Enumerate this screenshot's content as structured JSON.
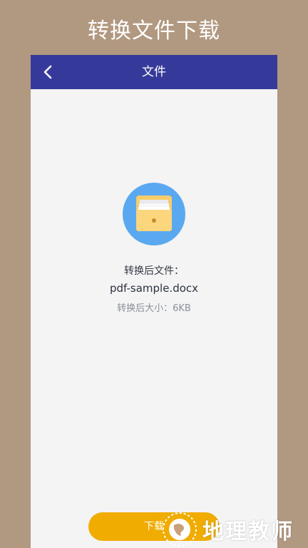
{
  "banner": {
    "title": "转换文件下载"
  },
  "navbar": {
    "title": "文件"
  },
  "file": {
    "converted_label": "转换后文件：",
    "name": "pdf-sample.docx",
    "size_text": "转换后大小：6KB"
  },
  "actions": {
    "download_label": "下载"
  },
  "watermark": {
    "text": "地理教师"
  },
  "colors": {
    "page_background": "#b19880",
    "navbar": "#353a9a",
    "content_background": "#f4f4f4",
    "icon_circle": "#5aa9f0",
    "folder": "#f6cd6a",
    "button": "#f0ac00"
  }
}
